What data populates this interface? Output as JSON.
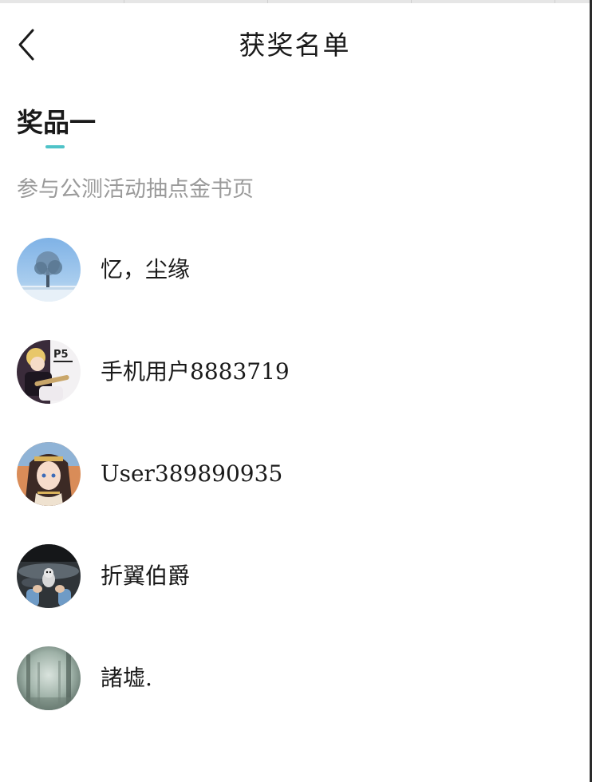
{
  "header": {
    "title": "获奖名单",
    "back_icon": "chevron-left-icon"
  },
  "section": {
    "title": "奖品一",
    "description": "参与公测活动抽点金书页",
    "accent_color": "#4fc3c8"
  },
  "winners": [
    {
      "name": "忆，尘缘",
      "avatar": "winter-tree-avatar"
    },
    {
      "name": "手机用户8883719",
      "avatar": "persona-anime-avatar"
    },
    {
      "name": "User389890935",
      "avatar": "anime-girl-avatar"
    },
    {
      "name": "折翼伯爵",
      "avatar": "dog-hands-avatar"
    },
    {
      "name": "諸墟.",
      "avatar": "misty-forest-avatar"
    }
  ]
}
